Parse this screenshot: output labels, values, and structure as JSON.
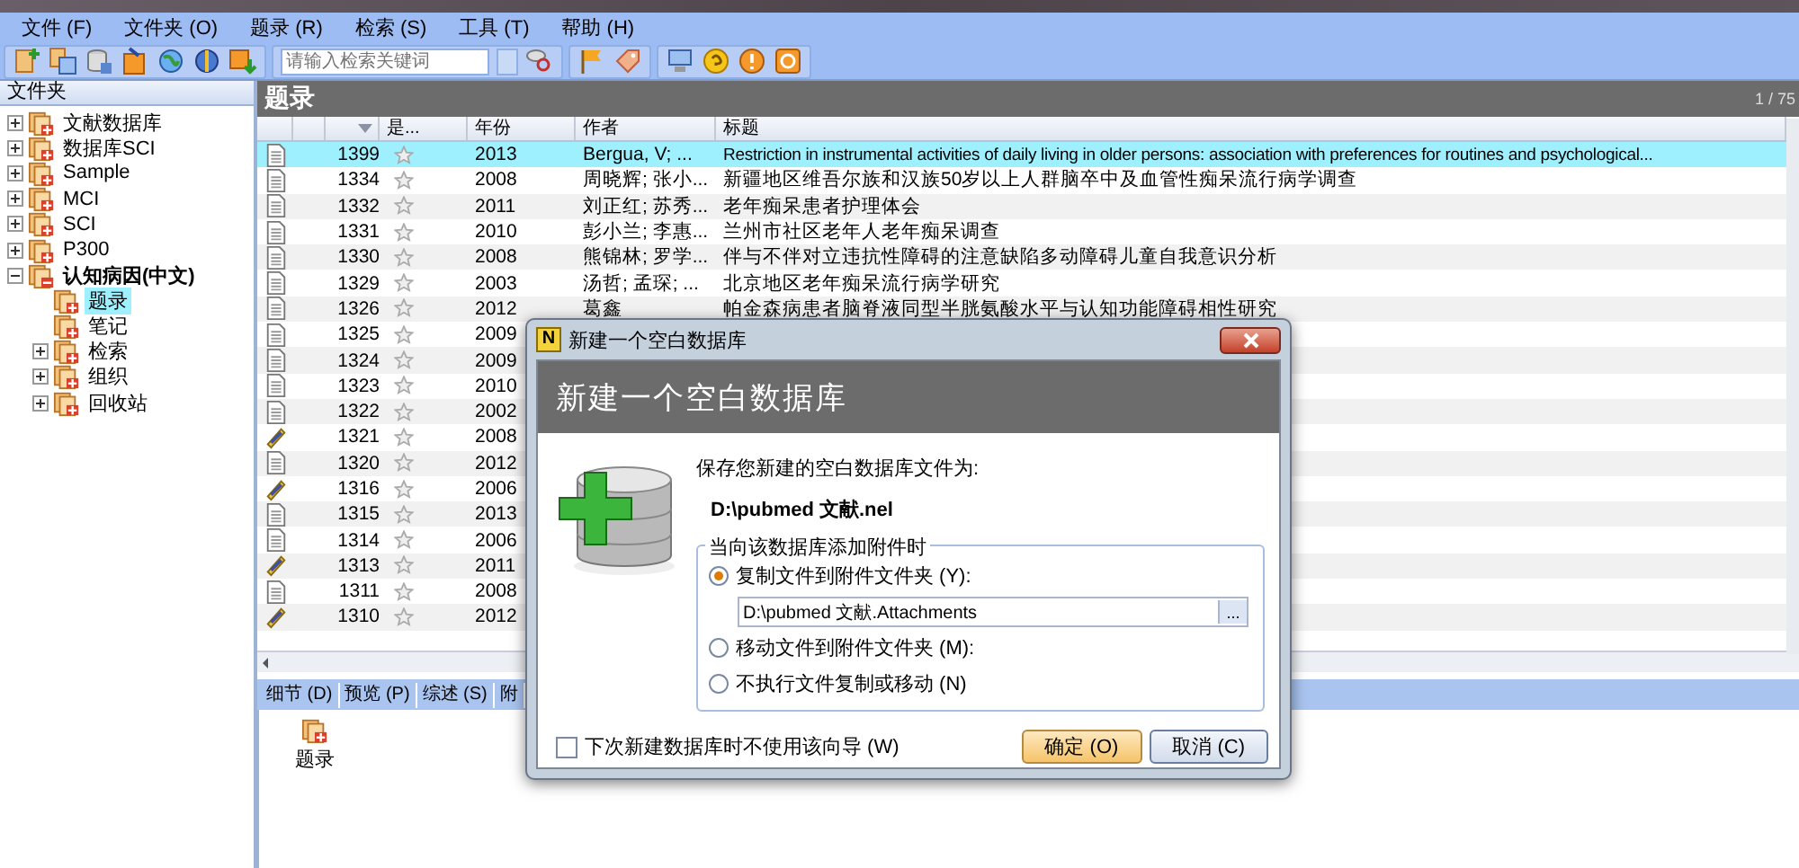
{
  "menu": [
    "文件 (F)",
    "文件夹 (O)",
    "题录 (R)",
    "检索 (S)",
    "工具 (T)",
    "帮助 (H)"
  ],
  "toolbar": {
    "search_placeholder": "请输入检索关键词"
  },
  "sidebar": {
    "title": "文件夹",
    "items": [
      {
        "label": "文献数据库",
        "expanded": false,
        "selected": false
      },
      {
        "label": "数据库SCI",
        "expanded": false,
        "selected": false
      },
      {
        "label": "Sample",
        "expanded": false,
        "selected": false
      },
      {
        "label": "MCI",
        "expanded": false,
        "selected": false
      },
      {
        "label": "SCI",
        "expanded": false,
        "selected": false
      },
      {
        "label": "P300",
        "expanded": false,
        "selected": false
      },
      {
        "label": "认知病因(中文)",
        "expanded": true,
        "selected": false,
        "children": [
          {
            "label": "题录",
            "selected": true
          },
          {
            "label": "笔记",
            "selected": false
          },
          {
            "label": "检索",
            "expanded": false,
            "selected": false
          },
          {
            "label": "组织",
            "expanded": false,
            "selected": false
          },
          {
            "label": "回收站",
            "expanded": false,
            "selected": false
          }
        ]
      }
    ]
  },
  "table": {
    "title": "题录",
    "page": "1 / 75",
    "columns": [
      "是...",
      "年份",
      "作者",
      "标题"
    ],
    "rows": [
      {
        "kind": "document",
        "number": "1399",
        "year": "2013",
        "author": "Bergua, V; ...",
        "title": "Restriction in instrumental activities of daily living in older persons: association with preferences for routines and psychological...",
        "selected": true
      },
      {
        "kind": "document",
        "number": "1334",
        "year": "2008",
        "author": "周晓辉; 张小...",
        "title": "新疆地区维吾尔族和汉族50岁以上人群脑卒中及血管性痴呆流行病学调查",
        "selected": false
      },
      {
        "kind": "document",
        "number": "1332",
        "year": "2011",
        "author": "刘正红; 苏秀...",
        "title": "老年痴呆患者护理体会",
        "selected": false
      },
      {
        "kind": "document",
        "number": "1331",
        "year": "2010",
        "author": "彭小兰; 李惠...",
        "title": "兰州市社区老年人老年痴呆调查",
        "selected": false
      },
      {
        "kind": "document",
        "number": "1330",
        "year": "2008",
        "author": "熊锦林; 罗学...",
        "title": "伴与不伴对立违抗性障碍的注意缺陷多动障碍儿童自我意识分析",
        "selected": false
      },
      {
        "kind": "document",
        "number": "1329",
        "year": "2003",
        "author": "汤哲; 孟琛; ...",
        "title": "北京地区老年痴呆流行病学研究",
        "selected": false
      },
      {
        "kind": "document",
        "number": "1326",
        "year": "2012",
        "author": "葛鑫",
        "title": "帕金森病患者脑脊液同型半胱氨酸水平与认知功能障碍相性研究",
        "selected": false
      },
      {
        "kind": "document",
        "number": "1325",
        "year": "2009",
        "selected": false
      },
      {
        "kind": "document",
        "number": "1324",
        "year": "2009",
        "selected": false
      },
      {
        "kind": "document",
        "number": "1323",
        "year": "2010",
        "selected": false
      },
      {
        "kind": "document",
        "number": "1322",
        "year": "2002",
        "selected": false
      },
      {
        "kind": "attachment",
        "number": "1321",
        "year": "2008",
        "selected": false
      },
      {
        "kind": "document",
        "number": "1320",
        "year": "2012",
        "selected": false
      },
      {
        "kind": "attachment",
        "number": "1316",
        "year": "2006",
        "selected": false
      },
      {
        "kind": "document",
        "number": "1315",
        "year": "2013",
        "selected": false
      },
      {
        "kind": "document",
        "number": "1314",
        "year": "2006",
        "selected": false
      },
      {
        "kind": "attachment",
        "number": "1313",
        "year": "2011",
        "selected": false
      },
      {
        "kind": "document",
        "number": "1311",
        "year": "2008",
        "selected": false
      },
      {
        "kind": "attachment",
        "number": "1310",
        "year": "2012",
        "selected": false
      }
    ]
  },
  "bottom_tabs": [
    "细节 (D)",
    "预览 (P)",
    "综述 (S)",
    "附"
  ],
  "bottom_pane": {
    "item": "题录"
  },
  "dialog": {
    "app_icon": "N",
    "title": "新建一个空白数据库",
    "heading": "新建一个空白数据库",
    "prompt": "保存您新建的空白数据库文件为:",
    "path": "D:\\pubmed 文献.nel",
    "group_label": "当向该数据库添加附件时",
    "options": [
      {
        "label": "复制文件到附件文件夹 (Y):",
        "selected": true
      },
      {
        "label": "移动文件到附件文件夹 (M):",
        "selected": false
      },
      {
        "label": "不执行文件复制或移动 (N)",
        "selected": false
      }
    ],
    "attachment_path": "D:\\pubmed 文献.Attachments",
    "browse_button": "...",
    "checkbox": {
      "label": "下次新建数据库时不使用该向导 (W)",
      "checked": false
    },
    "buttons": [
      {
        "label": "确定 (O)",
        "kind": "default"
      },
      {
        "label": "取消 (C)",
        "kind": "normal"
      }
    ]
  }
}
